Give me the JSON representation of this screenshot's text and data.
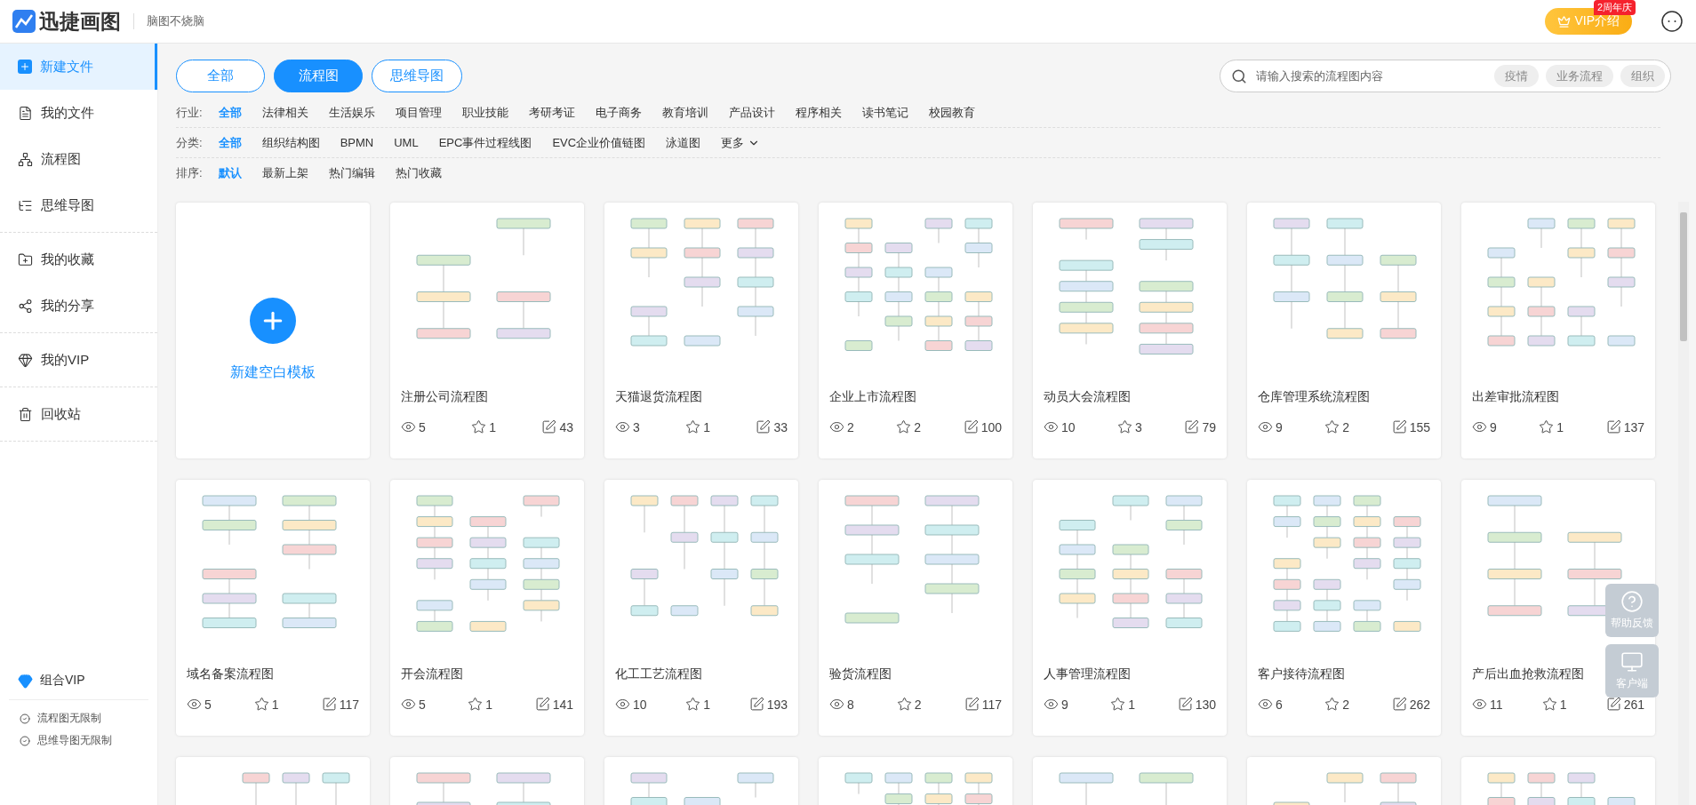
{
  "header": {
    "logo_text": "迅捷画图",
    "slogan": "脑图不烧脑",
    "vip_button": "VIP介绍",
    "vip_badge": "2周年庆"
  },
  "sidebar": {
    "groups": [
      {
        "items": [
          {
            "label": "新建文件",
            "selected": true
          },
          {
            "label": "我的文件",
            "selected": false
          },
          {
            "label": "流程图",
            "selected": false
          },
          {
            "label": "思维导图",
            "selected": false
          }
        ]
      },
      {
        "items": [
          {
            "label": "我的收藏",
            "selected": false
          },
          {
            "label": "我的分享",
            "selected": false
          }
        ]
      },
      {
        "items": [
          {
            "label": "我的VIP",
            "selected": false
          }
        ]
      },
      {
        "items": [
          {
            "label": "回收站",
            "selected": false
          }
        ]
      }
    ],
    "promo": {
      "title": "组合VIP",
      "features": [
        "流程图无限制",
        "思维导图无限制"
      ]
    }
  },
  "tabs": [
    {
      "label": "全部",
      "selected": false
    },
    {
      "label": "流程图",
      "selected": true
    },
    {
      "label": "思维导图",
      "selected": false
    }
  ],
  "search": {
    "placeholder": "请输入搜索的流程图内容",
    "tags": [
      "疫情",
      "业务流程",
      "组织"
    ]
  },
  "filters": [
    {
      "label": "行业:",
      "options": [
        {
          "label": "全部",
          "selected": true
        },
        {
          "label": "法律相关",
          "selected": false
        },
        {
          "label": "生活娱乐",
          "selected": false
        },
        {
          "label": "项目管理",
          "selected": false
        },
        {
          "label": "职业技能",
          "selected": false
        },
        {
          "label": "考研考证",
          "selected": false
        },
        {
          "label": "电子商务",
          "selected": false
        },
        {
          "label": "教育培训",
          "selected": false
        },
        {
          "label": "产品设计",
          "selected": false
        },
        {
          "label": "程序相关",
          "selected": false
        },
        {
          "label": "读书笔记",
          "selected": false
        },
        {
          "label": "校园教育",
          "selected": false
        }
      ]
    },
    {
      "label": "分类:",
      "options": [
        {
          "label": "全部",
          "selected": true
        },
        {
          "label": "组织结构图",
          "selected": false
        },
        {
          "label": "BPMN",
          "selected": false
        },
        {
          "label": "UML",
          "selected": false
        },
        {
          "label": "EPC事件过程线图",
          "selected": false
        },
        {
          "label": "EVC企业价值链图",
          "selected": false
        },
        {
          "label": "泳道图",
          "selected": false
        }
      ],
      "more": "更多"
    },
    {
      "label": "排序:",
      "options": [
        {
          "label": "默认",
          "selected": true
        },
        {
          "label": "最新上架",
          "selected": false
        },
        {
          "label": "热门编辑",
          "selected": false
        },
        {
          "label": "热门收藏",
          "selected": false
        }
      ]
    }
  ],
  "new_template": {
    "label": "新建空白模板"
  },
  "templates": [
    {
      "title": "注册公司流程图",
      "views": "5",
      "stars": "1",
      "edits": "43"
    },
    {
      "title": "天猫退货流程图",
      "views": "3",
      "stars": "1",
      "edits": "33"
    },
    {
      "title": "企业上市流程图",
      "views": "2",
      "stars": "2",
      "edits": "100"
    },
    {
      "title": "动员大会流程图",
      "views": "10",
      "stars": "3",
      "edits": "79"
    },
    {
      "title": "仓库管理系统流程图",
      "views": "9",
      "stars": "2",
      "edits": "155"
    },
    {
      "title": "出差审批流程图",
      "views": "9",
      "stars": "1",
      "edits": "137"
    },
    {
      "title": "域名备案流程图",
      "views": "5",
      "stars": "1",
      "edits": "117"
    },
    {
      "title": "开会流程图",
      "views": "5",
      "stars": "1",
      "edits": "141"
    },
    {
      "title": "化工工艺流程图",
      "views": "10",
      "stars": "1",
      "edits": "193"
    },
    {
      "title": "验货流程图",
      "views": "8",
      "stars": "2",
      "edits": "117"
    },
    {
      "title": "人事管理流程图",
      "views": "9",
      "stars": "1",
      "edits": "130"
    },
    {
      "title": "客户接待流程图",
      "views": "6",
      "stars": "2",
      "edits": "262"
    },
    {
      "title": "产后出血抢救流程图",
      "views": "11",
      "stars": "1",
      "edits": "261"
    }
  ],
  "float_buttons": [
    {
      "label": "帮助反馈"
    },
    {
      "label": "客户端"
    }
  ]
}
